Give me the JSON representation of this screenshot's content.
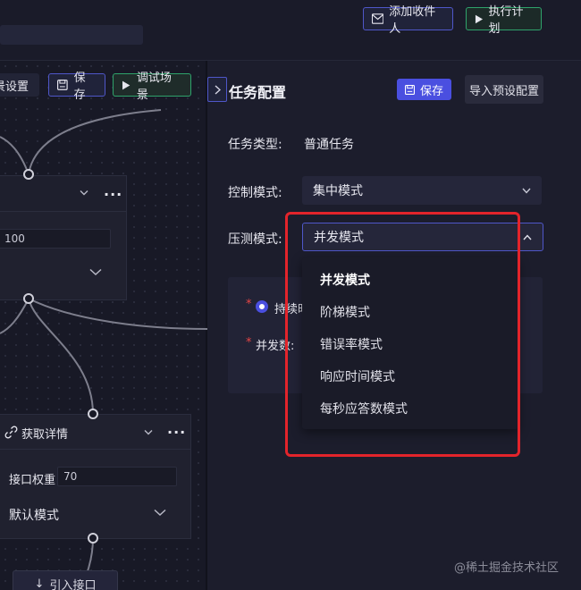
{
  "topbar": {
    "add_recipient": "添加收件人",
    "run_plan": "执行计划"
  },
  "canvas": {
    "scene_settings": "场景设置",
    "save": "保存",
    "debug_scene": "调试场景",
    "node1": {
      "field_value": "100"
    },
    "node2": {
      "title": "获取详情",
      "weight_label": "接口权重",
      "weight_value": "70",
      "mode_value": "默认模式"
    },
    "import_api": "引入接口"
  },
  "panel": {
    "title": "任务配置",
    "save": "保存",
    "import_preset": "导入预设配置",
    "task_type_label": "任务类型:",
    "task_type_value": "普通任务",
    "control_mode_label": "控制模式:",
    "control_mode_value": "集中模式",
    "press_mode_label": "压测模式:",
    "press_mode_value": "并发模式",
    "duration_label": "持续时",
    "concurrency_label": "并发数:",
    "press_mode_options": [
      "并发模式",
      "阶梯模式",
      "错误率模式",
      "响应时间模式",
      "每秒应答数模式"
    ]
  },
  "watermark": "@稀土掘金技术社区",
  "colors": {
    "accent": "#4a4fe0",
    "success": "#2fa36b",
    "highlight": "#e3242b",
    "background": "#1b1c2b"
  }
}
